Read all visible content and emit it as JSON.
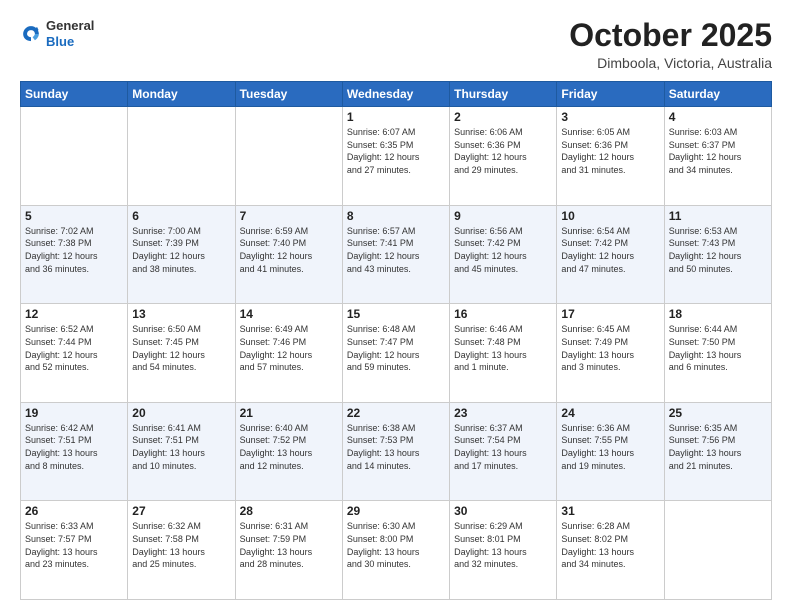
{
  "header": {
    "logo_general": "General",
    "logo_blue": "Blue",
    "month_title": "October 2025",
    "location": "Dimboola, Victoria, Australia"
  },
  "days_of_week": [
    "Sunday",
    "Monday",
    "Tuesday",
    "Wednesday",
    "Thursday",
    "Friday",
    "Saturday"
  ],
  "weeks": [
    {
      "days": [
        {
          "num": "",
          "info": ""
        },
        {
          "num": "",
          "info": ""
        },
        {
          "num": "",
          "info": ""
        },
        {
          "num": "1",
          "info": "Sunrise: 6:07 AM\nSunset: 6:35 PM\nDaylight: 12 hours\nand 27 minutes."
        },
        {
          "num": "2",
          "info": "Sunrise: 6:06 AM\nSunset: 6:36 PM\nDaylight: 12 hours\nand 29 minutes."
        },
        {
          "num": "3",
          "info": "Sunrise: 6:05 AM\nSunset: 6:36 PM\nDaylight: 12 hours\nand 31 minutes."
        },
        {
          "num": "4",
          "info": "Sunrise: 6:03 AM\nSunset: 6:37 PM\nDaylight: 12 hours\nand 34 minutes."
        }
      ]
    },
    {
      "days": [
        {
          "num": "5",
          "info": "Sunrise: 7:02 AM\nSunset: 7:38 PM\nDaylight: 12 hours\nand 36 minutes."
        },
        {
          "num": "6",
          "info": "Sunrise: 7:00 AM\nSunset: 7:39 PM\nDaylight: 12 hours\nand 38 minutes."
        },
        {
          "num": "7",
          "info": "Sunrise: 6:59 AM\nSunset: 7:40 PM\nDaylight: 12 hours\nand 41 minutes."
        },
        {
          "num": "8",
          "info": "Sunrise: 6:57 AM\nSunset: 7:41 PM\nDaylight: 12 hours\nand 43 minutes."
        },
        {
          "num": "9",
          "info": "Sunrise: 6:56 AM\nSunset: 7:42 PM\nDaylight: 12 hours\nand 45 minutes."
        },
        {
          "num": "10",
          "info": "Sunrise: 6:54 AM\nSunset: 7:42 PM\nDaylight: 12 hours\nand 47 minutes."
        },
        {
          "num": "11",
          "info": "Sunrise: 6:53 AM\nSunset: 7:43 PM\nDaylight: 12 hours\nand 50 minutes."
        }
      ]
    },
    {
      "days": [
        {
          "num": "12",
          "info": "Sunrise: 6:52 AM\nSunset: 7:44 PM\nDaylight: 12 hours\nand 52 minutes."
        },
        {
          "num": "13",
          "info": "Sunrise: 6:50 AM\nSunset: 7:45 PM\nDaylight: 12 hours\nand 54 minutes."
        },
        {
          "num": "14",
          "info": "Sunrise: 6:49 AM\nSunset: 7:46 PM\nDaylight: 12 hours\nand 57 minutes."
        },
        {
          "num": "15",
          "info": "Sunrise: 6:48 AM\nSunset: 7:47 PM\nDaylight: 12 hours\nand 59 minutes."
        },
        {
          "num": "16",
          "info": "Sunrise: 6:46 AM\nSunset: 7:48 PM\nDaylight: 13 hours\nand 1 minute."
        },
        {
          "num": "17",
          "info": "Sunrise: 6:45 AM\nSunset: 7:49 PM\nDaylight: 13 hours\nand 3 minutes."
        },
        {
          "num": "18",
          "info": "Sunrise: 6:44 AM\nSunset: 7:50 PM\nDaylight: 13 hours\nand 6 minutes."
        }
      ]
    },
    {
      "days": [
        {
          "num": "19",
          "info": "Sunrise: 6:42 AM\nSunset: 7:51 PM\nDaylight: 13 hours\nand 8 minutes."
        },
        {
          "num": "20",
          "info": "Sunrise: 6:41 AM\nSunset: 7:51 PM\nDaylight: 13 hours\nand 10 minutes."
        },
        {
          "num": "21",
          "info": "Sunrise: 6:40 AM\nSunset: 7:52 PM\nDaylight: 13 hours\nand 12 minutes."
        },
        {
          "num": "22",
          "info": "Sunrise: 6:38 AM\nSunset: 7:53 PM\nDaylight: 13 hours\nand 14 minutes."
        },
        {
          "num": "23",
          "info": "Sunrise: 6:37 AM\nSunset: 7:54 PM\nDaylight: 13 hours\nand 17 minutes."
        },
        {
          "num": "24",
          "info": "Sunrise: 6:36 AM\nSunset: 7:55 PM\nDaylight: 13 hours\nand 19 minutes."
        },
        {
          "num": "25",
          "info": "Sunrise: 6:35 AM\nSunset: 7:56 PM\nDaylight: 13 hours\nand 21 minutes."
        }
      ]
    },
    {
      "days": [
        {
          "num": "26",
          "info": "Sunrise: 6:33 AM\nSunset: 7:57 PM\nDaylight: 13 hours\nand 23 minutes."
        },
        {
          "num": "27",
          "info": "Sunrise: 6:32 AM\nSunset: 7:58 PM\nDaylight: 13 hours\nand 25 minutes."
        },
        {
          "num": "28",
          "info": "Sunrise: 6:31 AM\nSunset: 7:59 PM\nDaylight: 13 hours\nand 28 minutes."
        },
        {
          "num": "29",
          "info": "Sunrise: 6:30 AM\nSunset: 8:00 PM\nDaylight: 13 hours\nand 30 minutes."
        },
        {
          "num": "30",
          "info": "Sunrise: 6:29 AM\nSunset: 8:01 PM\nDaylight: 13 hours\nand 32 minutes."
        },
        {
          "num": "31",
          "info": "Sunrise: 6:28 AM\nSunset: 8:02 PM\nDaylight: 13 hours\nand 34 minutes."
        },
        {
          "num": "",
          "info": ""
        }
      ]
    }
  ]
}
